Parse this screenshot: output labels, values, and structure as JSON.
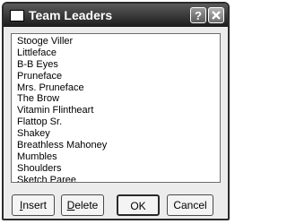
{
  "window": {
    "title": "Team Leaders",
    "help_label": "?"
  },
  "list": {
    "items": [
      "Stooge Viller",
      "Littleface",
      "B-B Eyes",
      "Pruneface",
      "Mrs. Pruneface",
      "The Brow",
      "Vitamin Flintheart",
      "Flattop Sr.",
      "Shakey",
      "Breathless Mahoney",
      "Mumbles",
      "Shoulders",
      "Sketch Paree"
    ]
  },
  "buttons": {
    "insert": {
      "mnemonic": "I",
      "rest": "nsert"
    },
    "delete": {
      "mnemonic": "D",
      "rest": "elete"
    },
    "ok": "OK",
    "cancel": "Cancel"
  },
  "icons": {
    "title_icon": "window-icon",
    "help": "help-icon",
    "close": "close-icon"
  }
}
